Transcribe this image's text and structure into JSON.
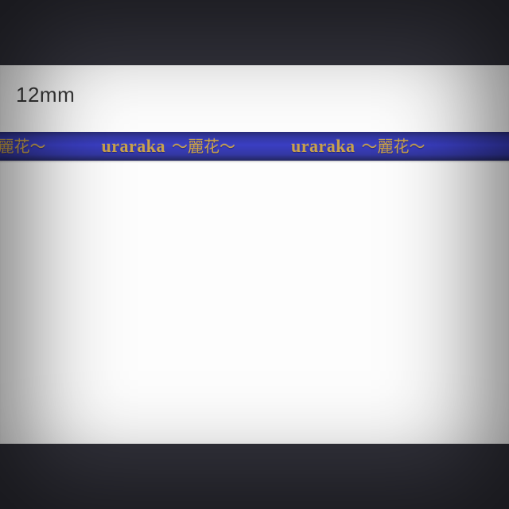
{
  "size_label": "12mm",
  "ribbon": {
    "brand_latin": "uraraka",
    "brand_kanji": "～麗花～",
    "colors": {
      "ribbon_base": "#3a3ec2",
      "ribbon_dark": "#23265f",
      "print_gold": "#caa24a"
    }
  }
}
